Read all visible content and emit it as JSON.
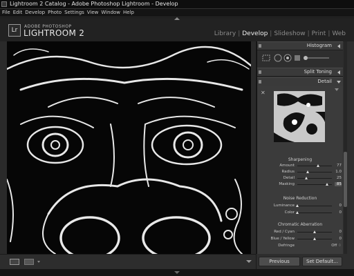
{
  "titlebar": {
    "title": "Lightroom 2 Catalog - Adobe Photoshop Lightroom - Develop"
  },
  "menubar": {
    "items": [
      "File",
      "Edit",
      "Develop",
      "Photo",
      "Settings",
      "View",
      "Window",
      "Help"
    ]
  },
  "brand": {
    "logo": "Lr",
    "small": "ADOBE PHOTOSHOP",
    "big": "LIGHTROOM 2"
  },
  "modules": [
    {
      "label": "Library"
    },
    {
      "label": "Develop",
      "active": true
    },
    {
      "label": "Slideshow"
    },
    {
      "label": "Print"
    },
    {
      "label": "Web"
    }
  ],
  "right_panel": {
    "histogram_label": "Histogram",
    "split_toning_label": "Split Toning",
    "detail_label": "Detail",
    "sharpening": {
      "title": "Sharpening",
      "rows": [
        {
          "label": "Amount",
          "value": "77",
          "level": 0.6
        },
        {
          "label": "Radius",
          "value": "1.0",
          "level": 0.3
        },
        {
          "label": "Detail",
          "value": "25",
          "level": 0.25
        },
        {
          "label": "Masking",
          "value": "85",
          "level": 0.85,
          "highlight": true
        }
      ]
    },
    "noise_reduction": {
      "title": "Noise Reduction",
      "rows": [
        {
          "label": "Luminance",
          "value": "0",
          "level": 0.0
        },
        {
          "label": "Color",
          "value": "0",
          "level": 0.0
        }
      ]
    },
    "chromatic_aberration": {
      "title": "Chromatic Aberration",
      "rows": [
        {
          "label": "Red / Cyan",
          "value": "0",
          "level": 0.5
        },
        {
          "label": "Blue / Yellow",
          "value": "0",
          "level": 0.5
        },
        {
          "label": "Defringe",
          "value": "Off ♢"
        }
      ]
    }
  },
  "buttons": {
    "previous": "Previous",
    "set_default": "Set Default..."
  }
}
